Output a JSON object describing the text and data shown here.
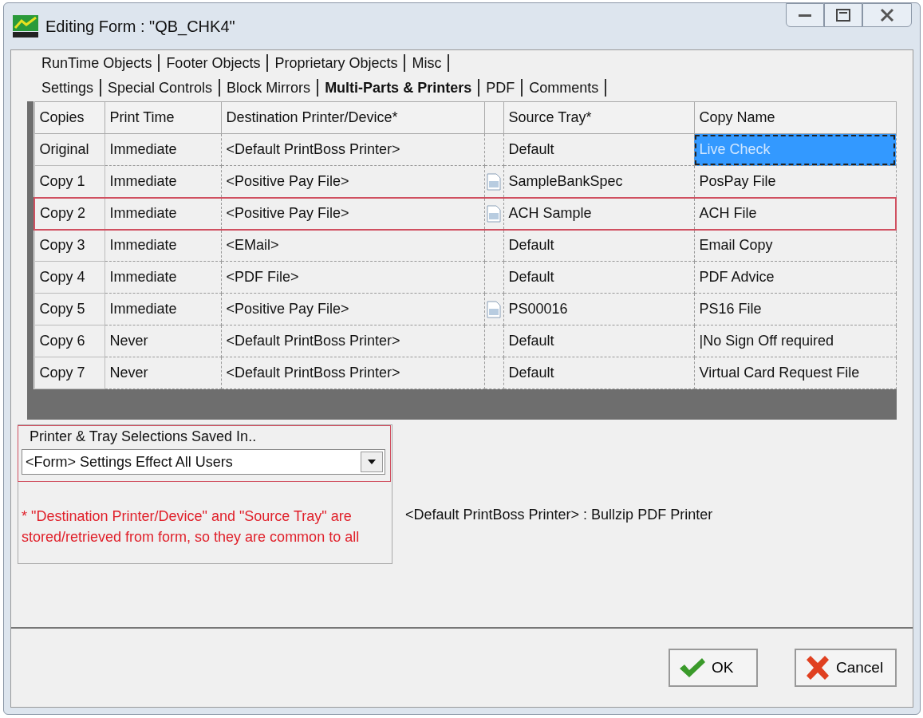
{
  "window": {
    "title": "Editing Form : \"QB_CHK4\""
  },
  "tab_rows": [
    [
      {
        "label": "RunTime Objects",
        "selected": false
      },
      {
        "label": "Footer Objects",
        "selected": false
      },
      {
        "label": "Proprietary Objects",
        "selected": false
      },
      {
        "label": "Misc",
        "selected": false
      }
    ],
    [
      {
        "label": "Settings",
        "selected": false
      },
      {
        "label": "Special Controls",
        "selected": false
      },
      {
        "label": "Block Mirrors",
        "selected": false
      },
      {
        "label": "Multi-Parts & Printers",
        "selected": true
      },
      {
        "label": "PDF",
        "selected": false
      },
      {
        "label": "Comments",
        "selected": false
      }
    ]
  ],
  "table": {
    "columns": [
      "Copies",
      "Print Time",
      "Destination Printer/Device*",
      "Source Tray*",
      "Copy Name"
    ],
    "rows": [
      {
        "copies": "Original",
        "print_time": "Immediate",
        "destination": "<Default PrintBoss Printer>",
        "file_icon": false,
        "source_tray": "Default",
        "copy_name": "Live Check",
        "selected": true,
        "highlighted": false
      },
      {
        "copies": "Copy 1",
        "print_time": "Immediate",
        "destination": "<Positive Pay File>",
        "file_icon": true,
        "source_tray": "SampleBankSpec",
        "copy_name": "PosPay File",
        "selected": false,
        "highlighted": false
      },
      {
        "copies": "Copy 2",
        "print_time": "Immediate",
        "destination": "<Positive Pay File>",
        "file_icon": true,
        "source_tray": "ACH Sample",
        "copy_name": "ACH File",
        "selected": false,
        "highlighted": true
      },
      {
        "copies": "Copy 3",
        "print_time": "Immediate",
        "destination": "<EMail>",
        "file_icon": false,
        "source_tray": "Default",
        "copy_name": "Email Copy",
        "selected": false,
        "highlighted": false
      },
      {
        "copies": "Copy 4",
        "print_time": "Immediate",
        "destination": "<PDF File>",
        "file_icon": false,
        "source_tray": "Default",
        "copy_name": "PDF Advice",
        "selected": false,
        "highlighted": false
      },
      {
        "copies": "Copy 5",
        "print_time": "Immediate",
        "destination": "<Positive Pay File>",
        "file_icon": true,
        "source_tray": "PS00016",
        "copy_name": "PS16 File",
        "selected": false,
        "highlighted": false
      },
      {
        "copies": "Copy 6",
        "print_time": "Never",
        "destination": "<Default PrintBoss Printer>",
        "file_icon": false,
        "source_tray": "Default",
        "copy_name": "|No Sign Off required",
        "selected": false,
        "highlighted": false
      },
      {
        "copies": "Copy 7",
        "print_time": "Never",
        "destination": "<Default PrintBoss Printer>",
        "file_icon": false,
        "source_tray": "Default",
        "copy_name": "Virtual Card Request File",
        "selected": false,
        "highlighted": false
      }
    ]
  },
  "saved_in": {
    "label": "Printer & Tray Selections Saved In..",
    "value": "<Form> Settings Effect All Users",
    "highlighted": true,
    "note": "* \"Destination Printer/Device\" and \"Source Tray\" are stored/retrieved from form, so they are common to all"
  },
  "default_printer": "<Default PrintBoss Printer> : Bullzip PDF Printer",
  "buttons": [
    {
      "label": "OK",
      "kind": "ok"
    },
    {
      "label": "Cancel",
      "kind": "cancel"
    }
  ]
}
